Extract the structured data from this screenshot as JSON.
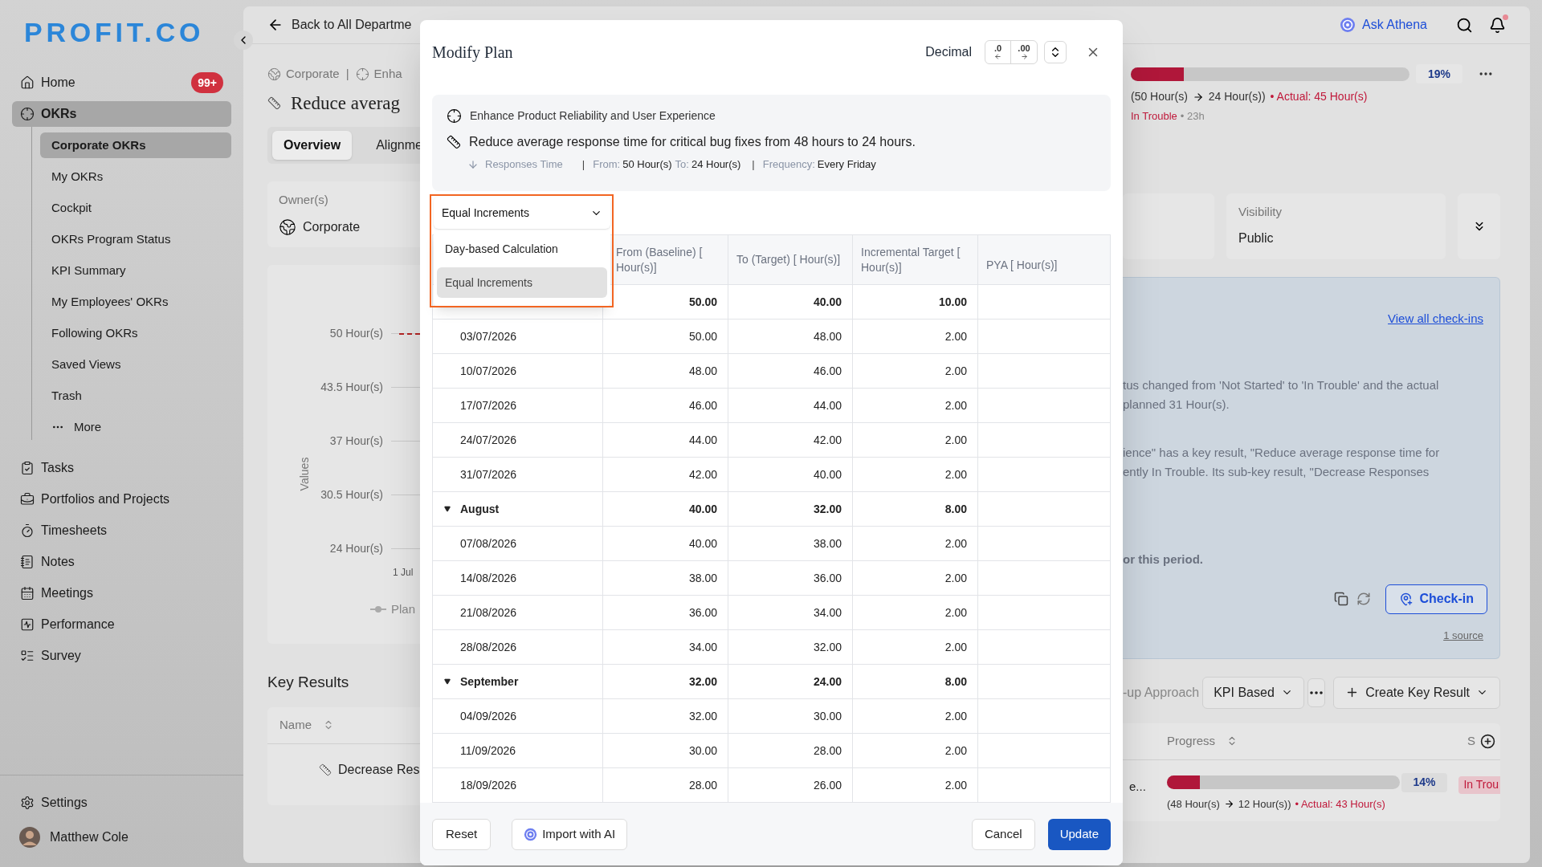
{
  "sidebar": {
    "logo": "PROFIT.CO",
    "nav": [
      {
        "label": "Home",
        "badge": "99+",
        "selected": false
      },
      {
        "label": "OKRs",
        "selected": true,
        "children": [
          {
            "kind": "link",
            "label": "Corporate OKRs",
            "selected": true
          },
          {
            "kind": "link",
            "label": "My OKRs",
            "selected": false
          },
          {
            "kind": "link",
            "label": "Cockpit",
            "selected": false
          },
          {
            "kind": "link",
            "label": "OKRs Program Status",
            "selected": false
          },
          {
            "kind": "link",
            "label": "KPI Summary",
            "selected": false
          },
          {
            "kind": "link",
            "label": "My Employees' OKRs",
            "selected": false
          },
          {
            "kind": "link",
            "label": "Following OKRs",
            "selected": false
          },
          {
            "kind": "link",
            "label": "Saved Views",
            "selected": false
          },
          {
            "kind": "link",
            "label": "Trash",
            "selected": false
          },
          {
            "kind": "more",
            "label": "More",
            "selected": false
          }
        ]
      },
      {
        "label": "Tasks",
        "selected": false
      },
      {
        "label": "Portfolios and Projects",
        "selected": false
      },
      {
        "label": "Timesheets",
        "selected": false
      },
      {
        "label": "Notes",
        "selected": false
      },
      {
        "label": "Meetings",
        "selected": false
      },
      {
        "label": "Performance",
        "selected": false
      },
      {
        "label": "Survey",
        "selected": false
      }
    ],
    "settings": "Settings",
    "user": "Matthew Cole"
  },
  "page": {
    "back_link": "Back to All Departme",
    "breadcrumb": [
      {
        "kind": "globe",
        "text": "Corporate"
      },
      {
        "kind": "separator",
        "text": "|"
      },
      {
        "kind": "target",
        "text": "Enha"
      }
    ],
    "title": "Reduce averag",
    "tabs": [
      {
        "label": "Overview",
        "selected": true
      },
      {
        "label": "Alignme",
        "selected": false
      }
    ],
    "owner": {
      "label": "Owner(s)",
      "value": "Corporate"
    },
    "chart": {
      "y_label": "Values",
      "y_ticks": [
        "50 Hour(s)",
        "43.5 Hour(s)",
        "37 Hour(s)",
        "30.5 Hour(s)",
        "24 Hour(s)"
      ],
      "x_tick": "1 Jul",
      "legend": "Plan"
    },
    "key_results": {
      "heading": "Key Results",
      "column": "Name",
      "row": "Decrease Res"
    }
  },
  "header_actions": {
    "assistant": "Ask Athena",
    "unread": true
  },
  "progress": {
    "level": 0.19,
    "percent": "19%",
    "from": "(50 Hour(s)",
    "to": "24 Hour(s))",
    "actual": "• Actual: 45 Hour(s)",
    "status": "In Trouble",
    "age": "• 23h"
  },
  "visibility": {
    "label": "Visibility",
    "value": "Public"
  },
  "insight": {
    "link": "View all check-ins",
    "paragraphs": [
      [
        "tus changed from 'Not Started' to 'In Trouble' and the actual",
        "planned 31 Hour(s)."
      ],
      [
        "ience\" has a key result, \"Reduce average response time for",
        "ently In Trouble. Its sub-key result, \"Decrease Responses"
      ]
    ],
    "bold_line": "or this period.",
    "button": "Check-in",
    "source": "1 source"
  },
  "approach": {
    "label": "-up Approach",
    "select": "KPI Based",
    "create": "Create Key Result"
  },
  "kr_table": {
    "columns": [
      "Progress",
      "S"
    ],
    "rows": [
      {
        "name": "e...",
        "level": 0.14,
        "percent": "14%",
        "from": "(48 Hour(s)",
        "to": "12 Hour(s))",
        "actual": "• Actual: 43 Hour(s)",
        "status": "In Trou"
      }
    ]
  },
  "modal": {
    "title": "Modify Plan",
    "format_label": "Decimal",
    "decrease_decimals": ".0",
    "increase_decimals": ".00",
    "objective": "Enhance Product Reliability and User Experience",
    "key_result": "Reduce average response time for critical bug fixes from 48 hours to 24 hours.",
    "metric": [
      {
        "kind": "metric",
        "text": "Responses Time"
      },
      {
        "kind": "separator",
        "text": "|"
      },
      {
        "kind": "label",
        "text": "From:"
      },
      {
        "kind": "value",
        "text": "50 Hour(s)"
      },
      {
        "kind": "label",
        "text": "To:"
      },
      {
        "kind": "value",
        "text": "24 Hour(s)"
      },
      {
        "kind": "separator",
        "text": "|"
      },
      {
        "kind": "label",
        "text": "Frequency:"
      },
      {
        "kind": "value",
        "text": "Every Friday"
      }
    ],
    "method": {
      "value": "Equal Increments",
      "open": true,
      "highlighted": true,
      "options": [
        {
          "label": "Day-based Calculation",
          "selected": false
        },
        {
          "label": "Equal Increments",
          "selected": true
        }
      ]
    },
    "table": {
      "columns": [
        "From (Baseline) [ Hour(s)]",
        "To (Target) [ Hour(s)]",
        "Incremental Target [ Hour(s)]",
        "PYA [ Hour(s)]"
      ],
      "rows": [
        {
          "kind": "month",
          "values": [
            "50.00",
            "40.00",
            "10.00"
          ]
        },
        {
          "kind": "week",
          "label": "03/07/2026",
          "values": [
            "50.00",
            "48.00",
            "2.00"
          ]
        },
        {
          "kind": "week",
          "label": "10/07/2026",
          "values": [
            "48.00",
            "46.00",
            "2.00"
          ]
        },
        {
          "kind": "week",
          "label": "17/07/2026",
          "values": [
            "46.00",
            "44.00",
            "2.00"
          ]
        },
        {
          "kind": "week",
          "label": "24/07/2026",
          "values": [
            "44.00",
            "42.00",
            "2.00"
          ]
        },
        {
          "kind": "week",
          "label": "31/07/2026",
          "values": [
            "42.00",
            "40.00",
            "2.00"
          ]
        },
        {
          "kind": "month",
          "label": "August",
          "values": [
            "40.00",
            "32.00",
            "8.00"
          ]
        },
        {
          "kind": "week",
          "label": "07/08/2026",
          "values": [
            "40.00",
            "38.00",
            "2.00"
          ]
        },
        {
          "kind": "week",
          "label": "14/08/2026",
          "values": [
            "38.00",
            "36.00",
            "2.00"
          ]
        },
        {
          "kind": "week",
          "label": "21/08/2026",
          "values": [
            "36.00",
            "34.00",
            "2.00"
          ]
        },
        {
          "kind": "week",
          "label": "28/08/2026",
          "values": [
            "34.00",
            "32.00",
            "2.00"
          ]
        },
        {
          "kind": "month",
          "label": "September",
          "values": [
            "32.00",
            "24.00",
            "8.00"
          ]
        },
        {
          "kind": "week",
          "label": "04/09/2026",
          "values": [
            "32.00",
            "30.00",
            "2.00"
          ]
        },
        {
          "kind": "week",
          "label": "11/09/2026",
          "values": [
            "30.00",
            "28.00",
            "2.00"
          ]
        },
        {
          "kind": "week",
          "label": "18/09/2026",
          "values": [
            "28.00",
            "26.00",
            "2.00"
          ]
        }
      ]
    },
    "buttons": {
      "reset": "Reset",
      "import": "Import with AI",
      "cancel": "Cancel",
      "update": "Update"
    }
  }
}
